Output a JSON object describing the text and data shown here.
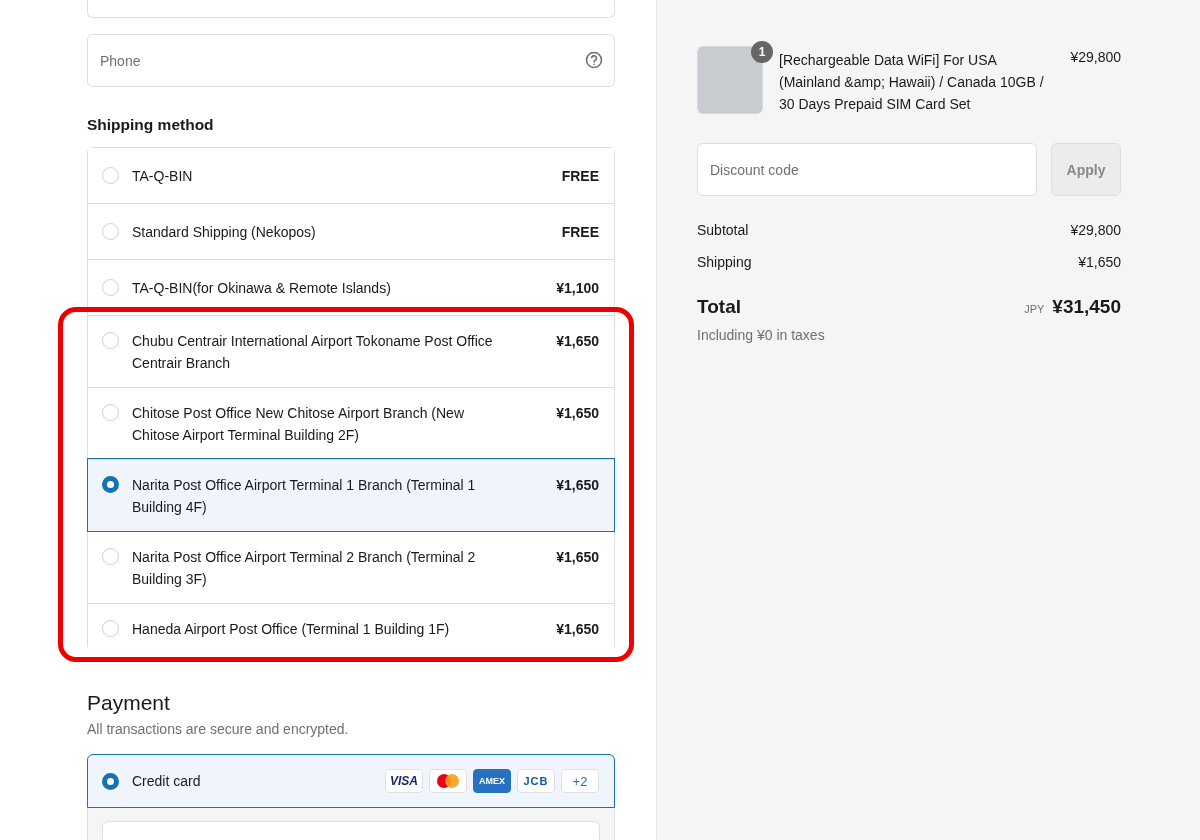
{
  "contact": {
    "phone": {
      "placeholder": "Phone"
    }
  },
  "shipping": {
    "title": "Shipping method",
    "methods": [
      {
        "name": "TA-Q-BIN",
        "price": "FREE",
        "selected": false,
        "circled": false
      },
      {
        "name": "Standard Shipping (Nekopos)",
        "price": "FREE",
        "selected": false,
        "circled": false
      },
      {
        "name": "TA-Q-BIN(for Okinawa & Remote Islands)",
        "price": "¥1,100",
        "selected": false,
        "circled": false
      },
      {
        "name": "Chubu Centrair International Airport Tokoname Post Office Centrair Branch",
        "price": "¥1,650",
        "selected": false,
        "circled": true
      },
      {
        "name": "Chitose Post Office New Chitose Airport Branch (New Chitose Airport Terminal Building 2F)",
        "price": "¥1,650",
        "selected": false,
        "circled": true
      },
      {
        "name": "Narita Post Office Airport Terminal 1 Branch (Terminal 1 Building 4F)",
        "price": "¥1,650",
        "selected": true,
        "circled": true
      },
      {
        "name": "Narita Post Office Airport Terminal 2 Branch (Terminal 2 Building 3F)",
        "price": "¥1,650",
        "selected": false,
        "circled": true
      },
      {
        "name": "Haneda Airport Post Office (Terminal 1 Building 1F)",
        "price": "¥1,650",
        "selected": false,
        "circled": true
      }
    ]
  },
  "payment": {
    "title": "Payment",
    "subtitle": "All transactions are secure and encrypted.",
    "methods": [
      {
        "name": "Credit card",
        "selected": true,
        "cards": [
          {
            "kind": "visa",
            "label": "VISA"
          },
          {
            "kind": "mastercard"
          },
          {
            "kind": "amex",
            "label": "AMEX"
          },
          {
            "kind": "jcb",
            "label": "JCB"
          },
          {
            "kind": "more",
            "label": "+2"
          }
        ]
      }
    ]
  },
  "summary": {
    "items": [
      {
        "quantity": "1",
        "title": "[Rechargeable Data WiFi] For USA (Mainland &amp; Hawaii) / Canada 10GB / 30 Days Prepaid SIM Card Set",
        "price": "¥29,800"
      }
    ],
    "discount": {
      "placeholder": "Discount code",
      "button": "Apply",
      "disabled": true
    },
    "lines": [
      {
        "label": "Subtotal",
        "value": "¥29,800"
      },
      {
        "label": "Shipping",
        "value": "¥1,650"
      }
    ],
    "total": {
      "label": "Total",
      "currency": "JPY",
      "value": "¥31,450",
      "note": "Including ¥0 in taxes"
    }
  }
}
